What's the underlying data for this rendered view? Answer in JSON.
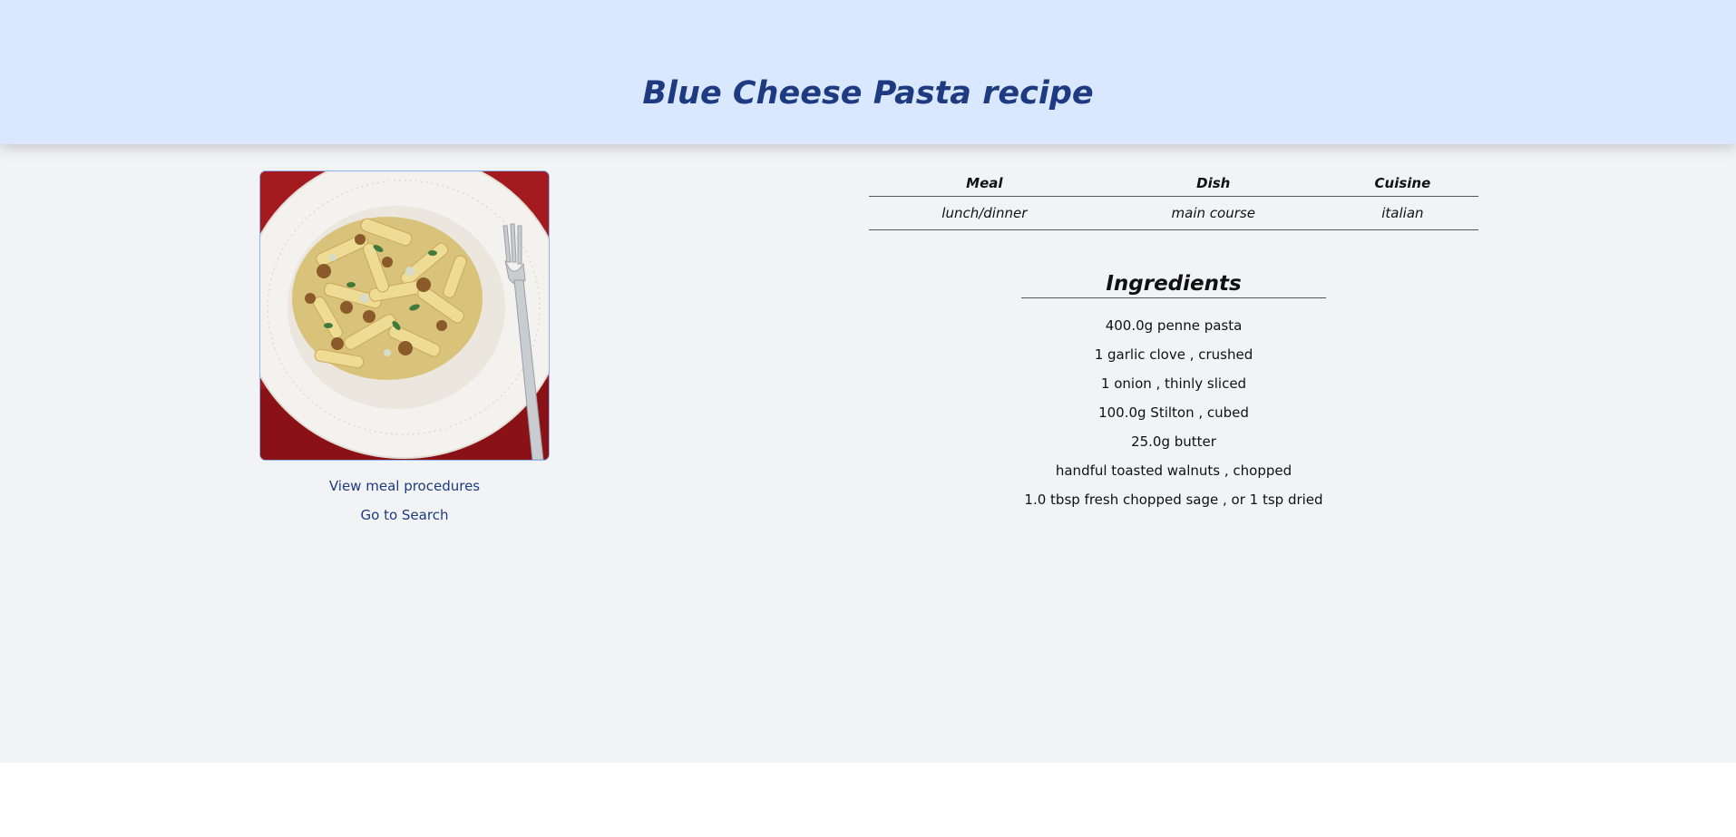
{
  "header": {
    "title": "Blue Cheese Pasta recipe"
  },
  "image": {
    "alt": "Blue cheese pasta with walnuts",
    "icon": "dish-photo"
  },
  "links": {
    "procedures": "View meal procedures",
    "search": "Go to Search"
  },
  "info_table": {
    "headers": [
      "Meal",
      "Dish",
      "Cuisine"
    ],
    "values": [
      "lunch/dinner",
      "main course",
      "italian"
    ]
  },
  "ingredients": {
    "heading": "Ingredients",
    "items": [
      "400.0g penne pasta",
      "1 garlic clove , crushed",
      "1 onion , thinly sliced",
      "100.0g Stilton , cubed",
      "25.0g butter",
      "handful toasted walnuts , chopped",
      "1.0 tbsp fresh chopped sage , or 1 tsp dried"
    ]
  },
  "colors": {
    "header_bg": "#d9e8ff",
    "title": "#1e3a80",
    "page_bg": "#f2f3f5",
    "link": "#1e3a80"
  }
}
